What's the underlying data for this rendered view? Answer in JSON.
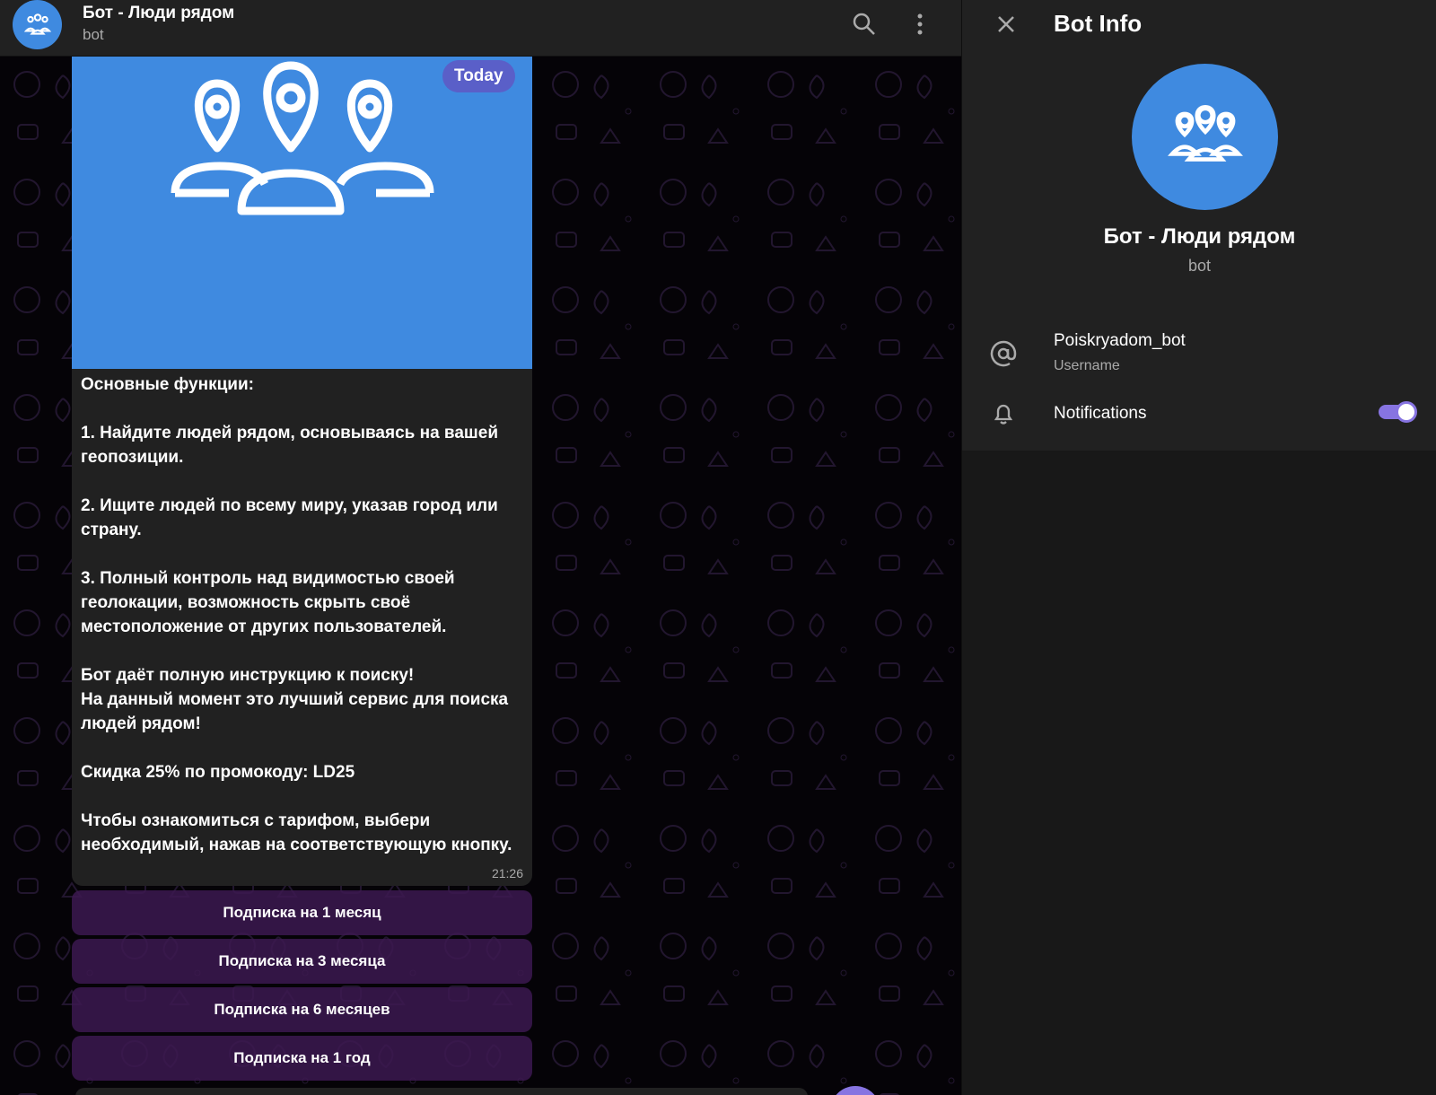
{
  "header": {
    "title": "Бот - Люди рядом",
    "subtitle": "bot",
    "icons": [
      "search-icon",
      "more-vertical-icon"
    ]
  },
  "message": {
    "date_badge": "Today",
    "text": "Основные функции:\n\n1. Найдите людей рядом, основываясь на вашей геопозиции.\n\n2. Ищите людей по всему миру, указав город или страну.\n\n3. Полный контроль над видимостью своей геолокации, возможность скрыть своё местоположение от других пользователей.\n\nБот даёт полную инструкцию к поиску!\nНа данный момент это лучший сервис для поиска людей рядом!\n\nСкидка 25% по промокоду: LD25\n\nЧтобы ознакомиться с тарифом, выбери необходимый, нажав на соответствующую кнопку.",
    "time": "21:26",
    "buttons": [
      "Подписка на 1 месяц",
      "Подписка на 3 месяца",
      "Подписка на 6 месяцев",
      "Подписка на 1 год"
    ]
  },
  "panel": {
    "title": "Bot Info",
    "name": "Бот - Люди рядом",
    "subtitle": "bot",
    "username": "Poiskryadom_bot",
    "username_label": "Username",
    "notifications_label": "Notifications",
    "notifications_on": true
  },
  "colors": {
    "accent": "#8774e1",
    "avatar": "#3f8ae0",
    "keyboard": "#3c1950"
  }
}
